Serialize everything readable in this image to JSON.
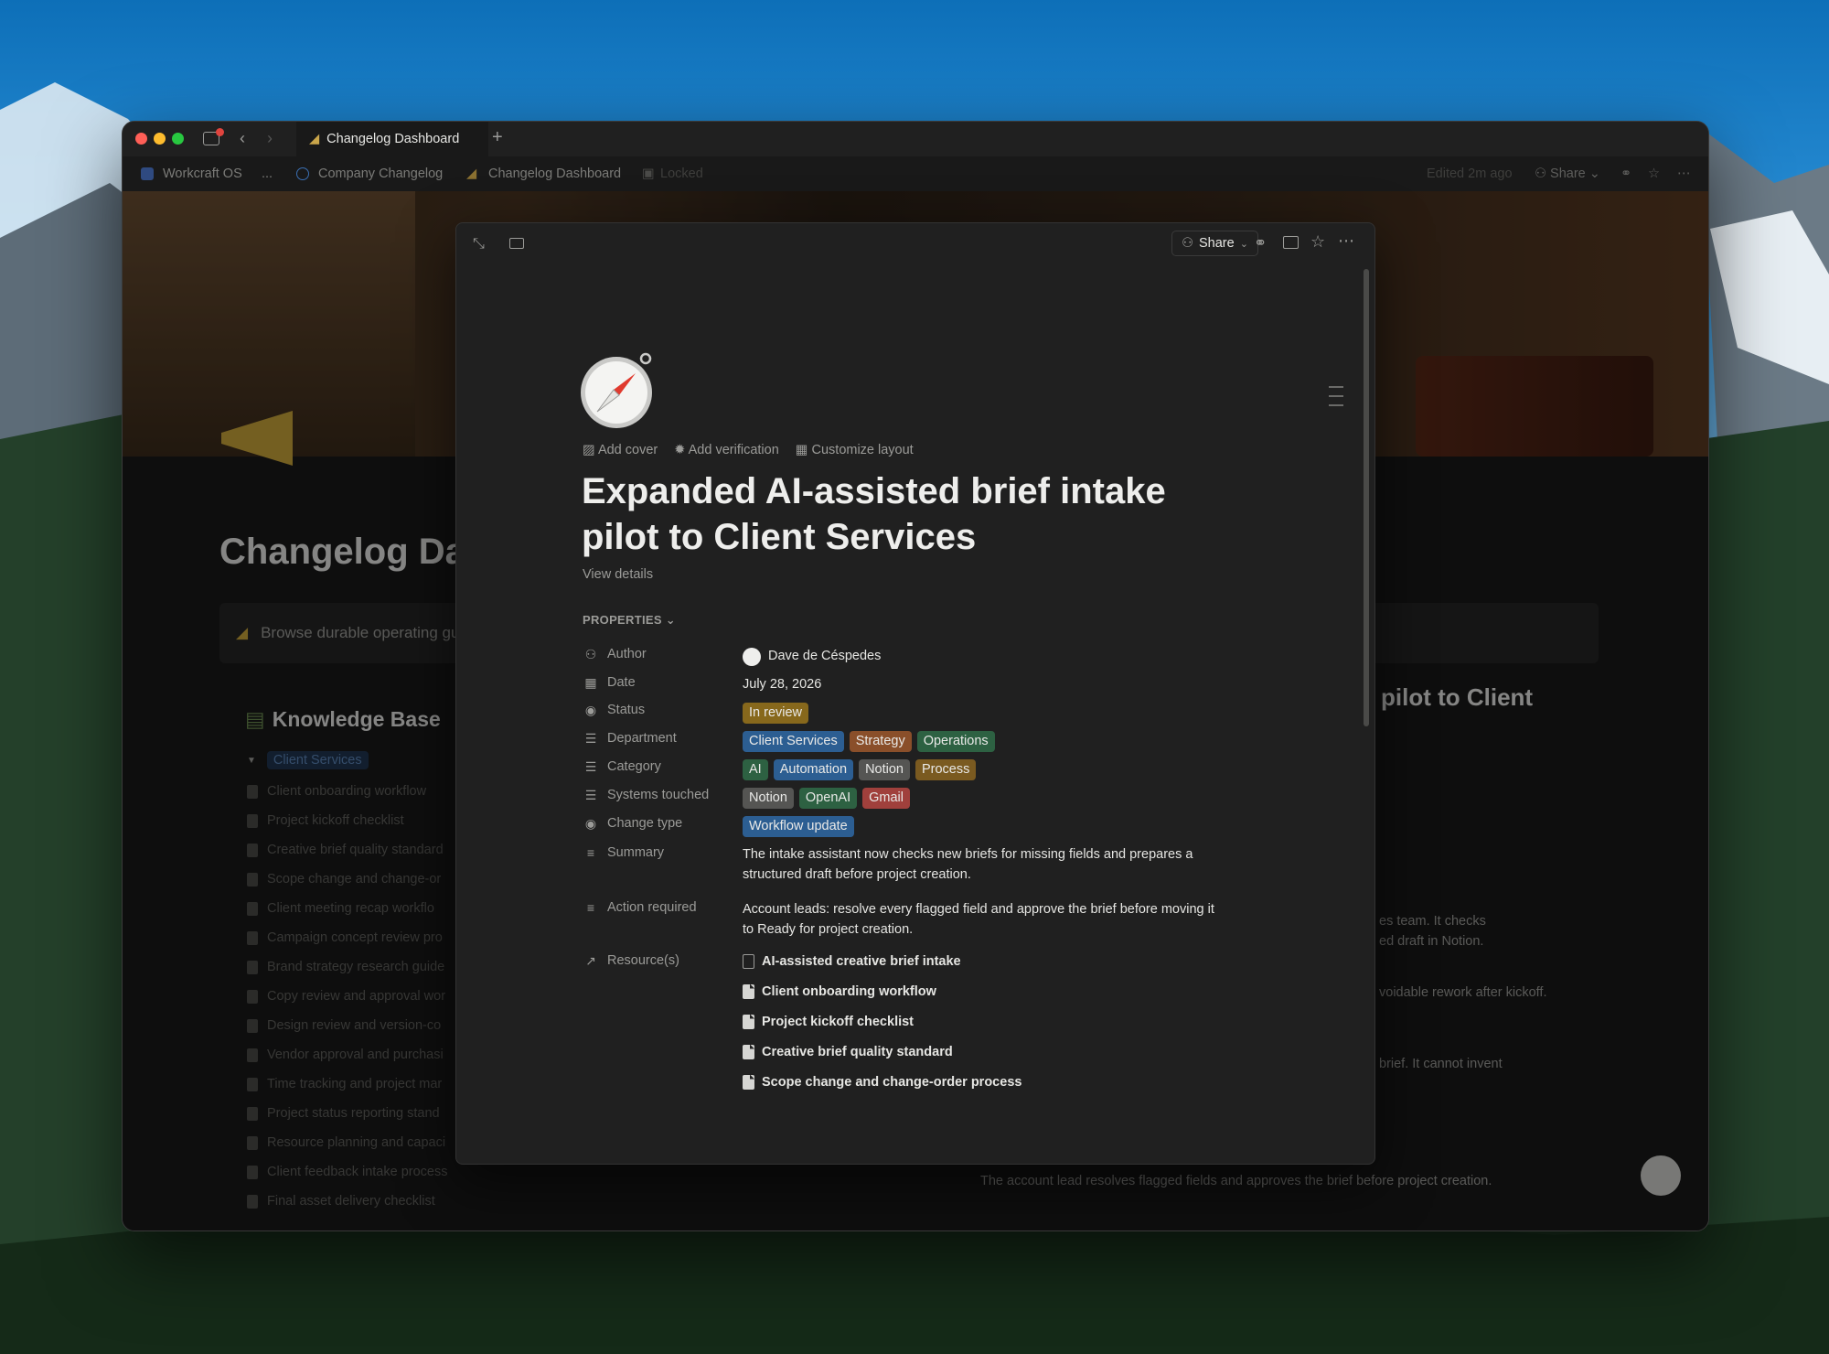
{
  "titlebar": {
    "tab_title": "Changelog Dashboard",
    "new_tab": "+"
  },
  "breadcrumb": {
    "items": [
      "Workcraft OS",
      "...",
      "Company Changelog",
      "Changelog Dashboard"
    ],
    "locked": "Locked",
    "edited": "Edited 2m ago",
    "share": "Share"
  },
  "background_page": {
    "title": "Changelog Da",
    "callout": "Browse durable operating gu",
    "kb_heading": "Knowledge Base",
    "group": "Client Services",
    "items": [
      "Client onboarding workflow",
      "Project kickoff checklist",
      "Creative brief quality standard",
      "Scope change and change-or",
      "Client meeting recap workflo",
      "Campaign concept review pro",
      "Brand strategy research guide",
      "Copy review and approval wor",
      "Design review and version-co",
      "Vendor approval and purchasi",
      "Time tracking and project mar",
      "Project status reporting stand",
      "Resource planning and capaci",
      "Client feedback intake process",
      "Final asset delivery checklist"
    ],
    "right_heading": "pilot to Client",
    "right_lines": [
      "es team. It checks",
      "ed draft in Notion.",
      "voidable rework after kickoff.",
      "brief. It cannot invent",
      "The account lead resolves flagged fields and approves the brief before project creation."
    ]
  },
  "modal": {
    "share": "Share",
    "page_actions": [
      "Add cover",
      "Add verification",
      "Customize layout"
    ],
    "title_line1": "Expanded AI-assisted brief intake",
    "title_line2": "pilot to Client Services",
    "view_details": "View details",
    "properties_label": "PROPERTIES",
    "properties": {
      "author": {
        "label": "Author",
        "value": "Dave de Céspedes"
      },
      "date": {
        "label": "Date",
        "value": "July 28, 2026"
      },
      "status": {
        "label": "Status",
        "value": "In review"
      },
      "department": {
        "label": "Department",
        "values": [
          "Client Services",
          "Strategy",
          "Operations"
        ]
      },
      "category": {
        "label": "Category",
        "values": [
          "AI",
          "Automation",
          "Notion",
          "Process"
        ]
      },
      "systems": {
        "label": "Systems touched",
        "values": [
          "Notion",
          "OpenAI",
          "Gmail"
        ]
      },
      "change_type": {
        "label": "Change type",
        "value": "Workflow update"
      },
      "summary": {
        "label": "Summary",
        "line1": "The intake assistant now checks new briefs for missing fields and prepares a",
        "line2": "structured draft before project creation."
      },
      "action": {
        "label": "Action required",
        "line1": "Account leads: resolve every flagged field and approve the brief before moving it",
        "line2": "to Ready for project creation."
      },
      "resources": {
        "label": "Resource(s)",
        "values": [
          "AI-assisted creative brief intake",
          "Client onboarding workflow",
          "Project kickoff checklist",
          "Creative brief quality standard",
          "Scope change and change-order process"
        ]
      }
    }
  }
}
